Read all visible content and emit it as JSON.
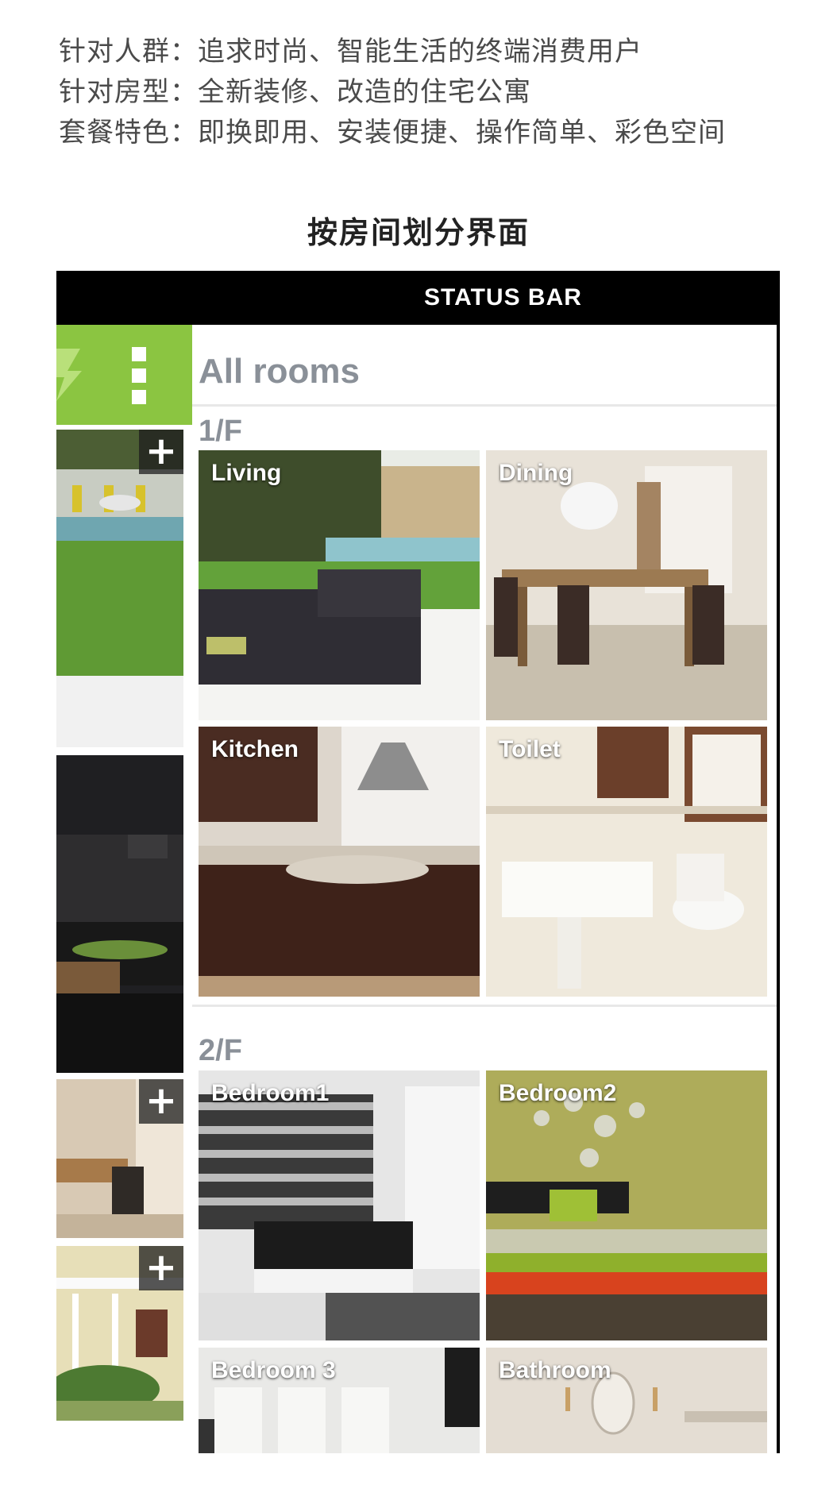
{
  "intro": {
    "line1": "针对人群：追求时尚、智能生活的终端消费用户",
    "line2": "针对房型：全新装修、改造的住宅公寓",
    "line3": "套餐特色：即换即用、安装便捷、操作简单、彩色空间"
  },
  "section_title": "按房间划分界面",
  "status_bar": {
    "label": "STATUS BAR"
  },
  "drawer": {
    "icons": [
      "lightning-icon",
      "kebab-menu-icon"
    ],
    "add_symbol": "+"
  },
  "main": {
    "title": "All rooms",
    "floors": [
      {
        "label": "1/F",
        "rooms": [
          "Living",
          "Dining",
          "Kitchen",
          "Toilet"
        ]
      },
      {
        "label": "2/F",
        "rooms": [
          "Bedroom1",
          "Bedroom2",
          "Bedroom 3",
          "Bathroom"
        ]
      }
    ]
  },
  "colors": {
    "accent_green": "#8bc541",
    "status_bar_bg": "#000000",
    "heading_gray": "#8a9098"
  }
}
